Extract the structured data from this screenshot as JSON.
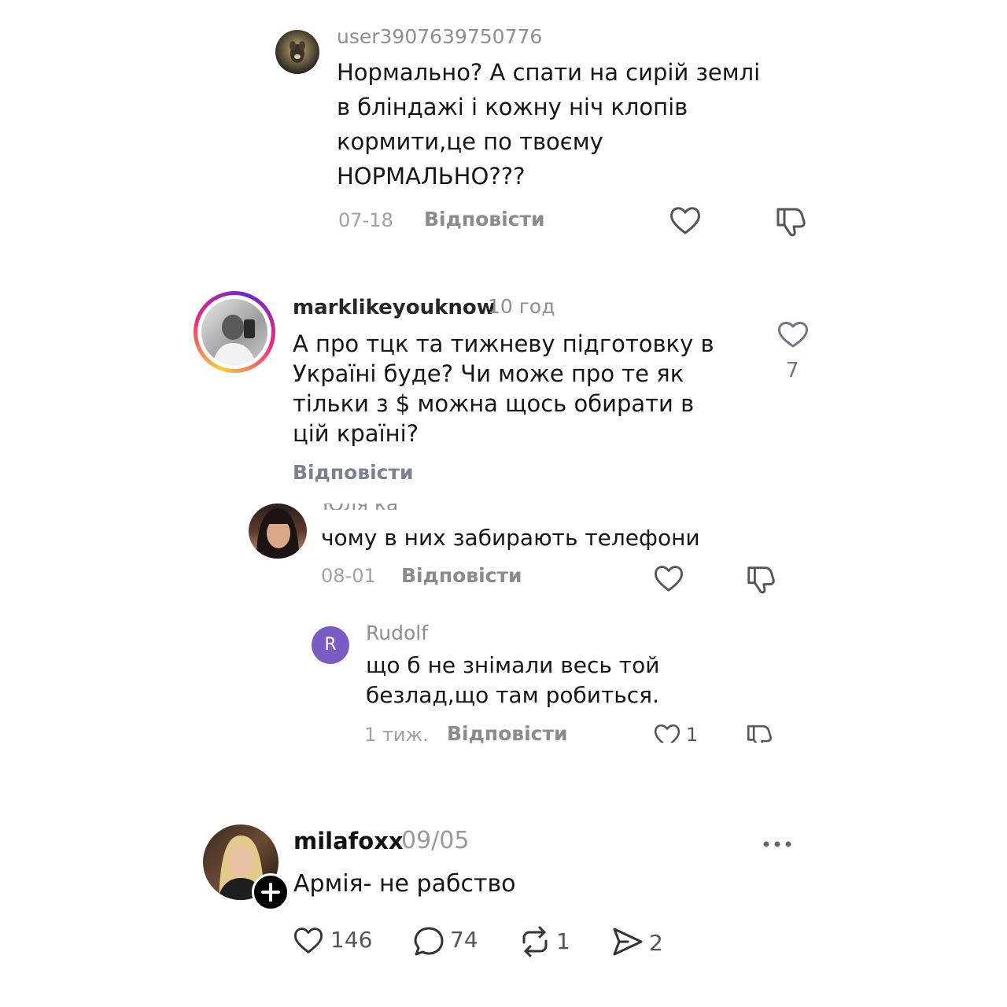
{
  "comment1": {
    "username": "user3907639750776",
    "lines": [
      "Нормально? А спати на сирій землі",
      "в бліндажі і кожну ніч клопів",
      "кормити,це по твоєму",
      "НОРМАЛЬНО???"
    ],
    "date": "07-18",
    "reply_label": "Відповісти",
    "like_icon": "heart-outline-icon",
    "dislike_icon": "thumbs-down-icon"
  },
  "comment2": {
    "username": "marklikeyouknow",
    "time": "10 год",
    "lines": [
      "А про тцк та тижневу підготовку в",
      "Україні буде? Чи може про те як",
      "тільки з $ можна щось обирати в",
      "цій країні?"
    ],
    "reply_label": "Відповісти",
    "like_count": "7",
    "like_icon": "heart-outline-icon"
  },
  "comment3": {
    "username_partial": "Юля ка",
    "text": "чому в них забирають телефони",
    "date": "08-01",
    "reply_label": "Відповісти"
  },
  "comment4": {
    "avatar_letter": "R",
    "avatar_color": "#7b5cc4",
    "username": "Rudolf",
    "lines": [
      "що б не знімали весь той",
      "безлад,що там робиться."
    ],
    "date": "1 тиж.",
    "reply_label": "Відповісти",
    "like_count": "1"
  },
  "comment5": {
    "username": "milafoxx",
    "date": "09/05",
    "text": "Армія- не рабство",
    "more_icon": "more-dots-icon",
    "stats": {
      "likes": "146",
      "comments": "74",
      "reposts": "1",
      "shares": "2"
    }
  },
  "colors": {
    "muted": "#8e8e93",
    "text": "#161616",
    "story_ring": [
      "#f9ce34",
      "#ee2a7b",
      "#6228d7"
    ]
  }
}
